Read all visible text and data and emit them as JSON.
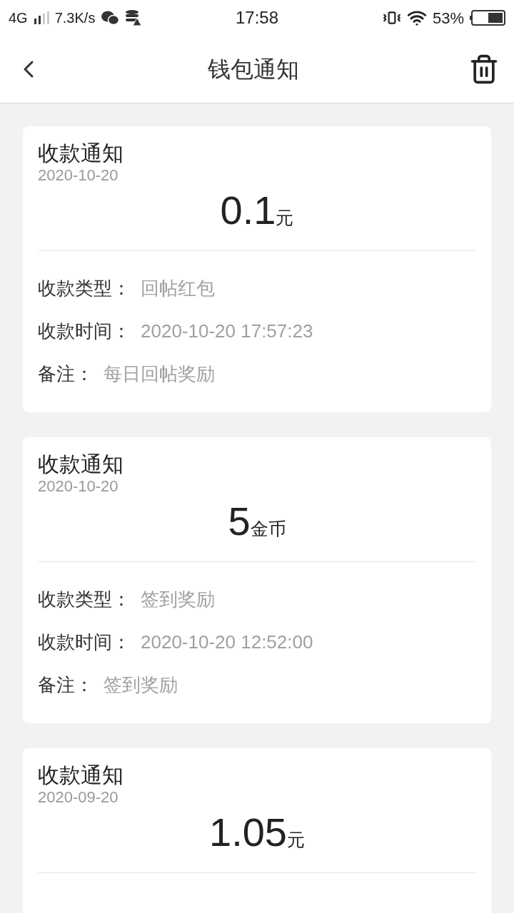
{
  "status_bar": {
    "network": "4G",
    "speed": "7.3K/s",
    "time": "17:58",
    "battery": "53%"
  },
  "header": {
    "title": "钱包通知"
  },
  "notices": [
    {
      "title": "收款通知",
      "date": "2020-10-20",
      "amount": "0.1",
      "unit": "元",
      "rows": [
        {
          "label": "收款类型：",
          "value": "回帖红包"
        },
        {
          "label": "收款时间：",
          "value": "2020-10-20 17:57:23"
        },
        {
          "label": "备注：",
          "value": "每日回帖奖励"
        }
      ]
    },
    {
      "title": "收款通知",
      "date": "2020-10-20",
      "amount": "5",
      "unit": "金币",
      "rows": [
        {
          "label": "收款类型：",
          "value": "签到奖励"
        },
        {
          "label": "收款时间：",
          "value": "2020-10-20 12:52:00"
        },
        {
          "label": "备注：",
          "value": "签到奖励"
        }
      ]
    },
    {
      "title": "收款通知",
      "date": "2020-09-20",
      "amount": "1.05",
      "unit": "元"
    }
  ]
}
